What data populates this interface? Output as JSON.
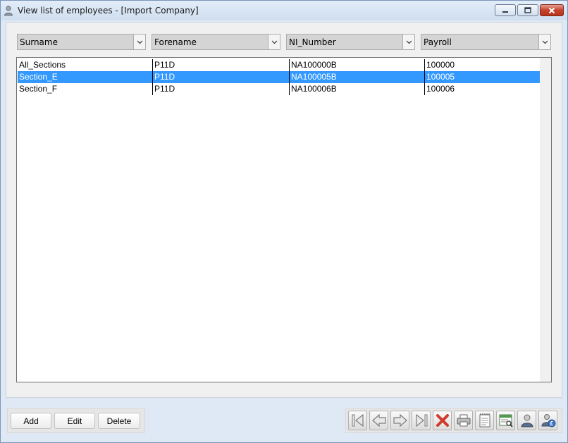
{
  "window": {
    "title": "View list of employees - [Import Company]"
  },
  "columns": [
    {
      "label": "Surname"
    },
    {
      "label": "Forename"
    },
    {
      "label": "NI_Number"
    },
    {
      "label": "Payroll"
    }
  ],
  "rows": [
    {
      "surname": "All_Sections",
      "forename": "P11D",
      "ni_number": "NA100000B",
      "payroll": "100000",
      "selected": false
    },
    {
      "surname": "Section_E",
      "forename": "P11D",
      "ni_number": "NA100005B",
      "payroll": "100005",
      "selected": true
    },
    {
      "surname": "Section_F",
      "forename": "P11D",
      "ni_number": "NA100006B",
      "payroll": "100006",
      "selected": false
    }
  ],
  "buttons": {
    "add": "Add",
    "edit": "Edit",
    "delete": "Delete"
  },
  "nav_icons": [
    "first-record-icon",
    "previous-record-icon",
    "next-record-icon",
    "last-record-icon",
    "delete-record-icon",
    "print-icon",
    "notes-icon",
    "report-preview-icon",
    "employee-icon",
    "employee-pay-icon"
  ],
  "colors": {
    "selection": "#3399ff",
    "selection_text": "#ffffff",
    "nav_arrow": "#8f8f8f",
    "delete_x": "#d23a2c"
  }
}
